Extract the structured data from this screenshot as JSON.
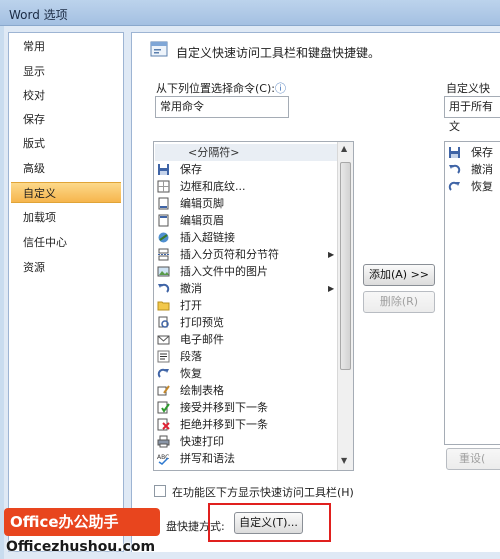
{
  "window": {
    "title": "Word 选项"
  },
  "sidebar": {
    "items": [
      {
        "label": "常用",
        "active": false
      },
      {
        "label": "显示",
        "active": false
      },
      {
        "label": "校对",
        "active": false
      },
      {
        "label": "保存",
        "active": false
      },
      {
        "label": "版式",
        "active": false
      },
      {
        "label": "高级",
        "active": false
      },
      {
        "label": "自定义",
        "active": true
      },
      {
        "label": "加载项",
        "active": false
      },
      {
        "label": "信任中心",
        "active": false
      },
      {
        "label": "资源",
        "active": false
      }
    ]
  },
  "header": {
    "text": "自定义快速访问工具栏和键盘快捷键。"
  },
  "choose_from": {
    "label": "从下列位置选择命令(C):",
    "info_icon": "ⓘ",
    "value": "常用命令"
  },
  "customize_for": {
    "label": "自定义快速",
    "value": "用于所有文"
  },
  "command_list": [
    {
      "label": "<分隔符>",
      "icon": "separator",
      "submenu": false
    },
    {
      "label": "保存",
      "icon": "save-icon",
      "submenu": false
    },
    {
      "label": "边框和底纹...",
      "icon": "borders-icon",
      "submenu": false
    },
    {
      "label": "编辑页脚",
      "icon": "footer-icon",
      "submenu": false
    },
    {
      "label": "编辑页眉",
      "icon": "header-icon",
      "submenu": false
    },
    {
      "label": "插入超链接",
      "icon": "hyperlink-icon",
      "submenu": false
    },
    {
      "label": "插入分页符和分节符",
      "icon": "page-break-icon",
      "submenu": true
    },
    {
      "label": "插入文件中的图片",
      "icon": "picture-icon",
      "submenu": false
    },
    {
      "label": "撤消",
      "icon": "undo-icon",
      "submenu": true
    },
    {
      "label": "打开",
      "icon": "open-folder-icon",
      "submenu": false
    },
    {
      "label": "打印预览",
      "icon": "print-preview-icon",
      "submenu": false
    },
    {
      "label": "电子邮件",
      "icon": "email-icon",
      "submenu": false
    },
    {
      "label": "段落",
      "icon": "paragraph-icon",
      "submenu": false
    },
    {
      "label": "恢复",
      "icon": "redo-icon",
      "submenu": false
    },
    {
      "label": "绘制表格",
      "icon": "draw-table-icon",
      "submenu": false
    },
    {
      "label": "接受并移到下一条",
      "icon": "accept-change-icon",
      "submenu": false
    },
    {
      "label": "拒绝并移到下一条",
      "icon": "reject-change-icon",
      "submenu": false
    },
    {
      "label": "快速打印",
      "icon": "quick-print-icon",
      "submenu": false
    },
    {
      "label": "拼写和语法",
      "icon": "spelling-icon",
      "submenu": false
    }
  ],
  "buttons": {
    "add": "添加(A) >>",
    "remove": "删除(R)",
    "reset": "重设(",
    "customize": "自定义(T)..."
  },
  "toolbar_list": [
    {
      "label": "保存",
      "icon": "save-icon"
    },
    {
      "label": "撤消",
      "icon": "undo-icon"
    },
    {
      "label": "恢复",
      "icon": "redo-icon"
    }
  ],
  "show_below_ribbon": {
    "label": "在功能区下方显示快速访问工具栏(H)",
    "checked": false
  },
  "shortcuts": {
    "label": "盘快捷方式:"
  },
  "watermark": {
    "line1": "Office办公助手",
    "line2": "Officezhushou.com"
  },
  "colors": {
    "active_item": "#f6b54d",
    "watermark_bg": "#e8451e",
    "highlight_box": "#e0201e"
  }
}
